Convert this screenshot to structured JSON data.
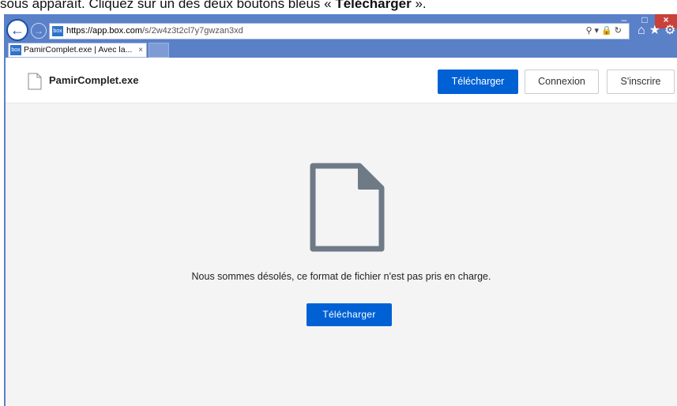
{
  "instruction": {
    "prefix": "sous apparaît. Cliquez sur un des deux boutons bleus « ",
    "bold": "Télécharger",
    "suffix": " »."
  },
  "browser": {
    "url_host": "https://app.box.com",
    "url_path": "/s/2w4z3t2cl7y7gwzan3xd",
    "favicon_label": "box",
    "tab_title": "PamirComplet.exe | Avec la...",
    "tab_close": "×",
    "window_controls": [
      "–",
      "□",
      "×"
    ]
  },
  "header": {
    "filename": "PamirComplet.exe",
    "download_label": "Télécharger",
    "login_label": "Connexion",
    "signup_label": "S'inscrire"
  },
  "main": {
    "message": "Nous sommes désolés, ce format de fichier n'est pas pris en charge.",
    "download_label": "Télécharger"
  },
  "colors": {
    "chrome": "#5a80c8",
    "primary_button": "#0061d5",
    "page_bg": "#f4f4f4",
    "file_icon": "#6e7a85"
  }
}
